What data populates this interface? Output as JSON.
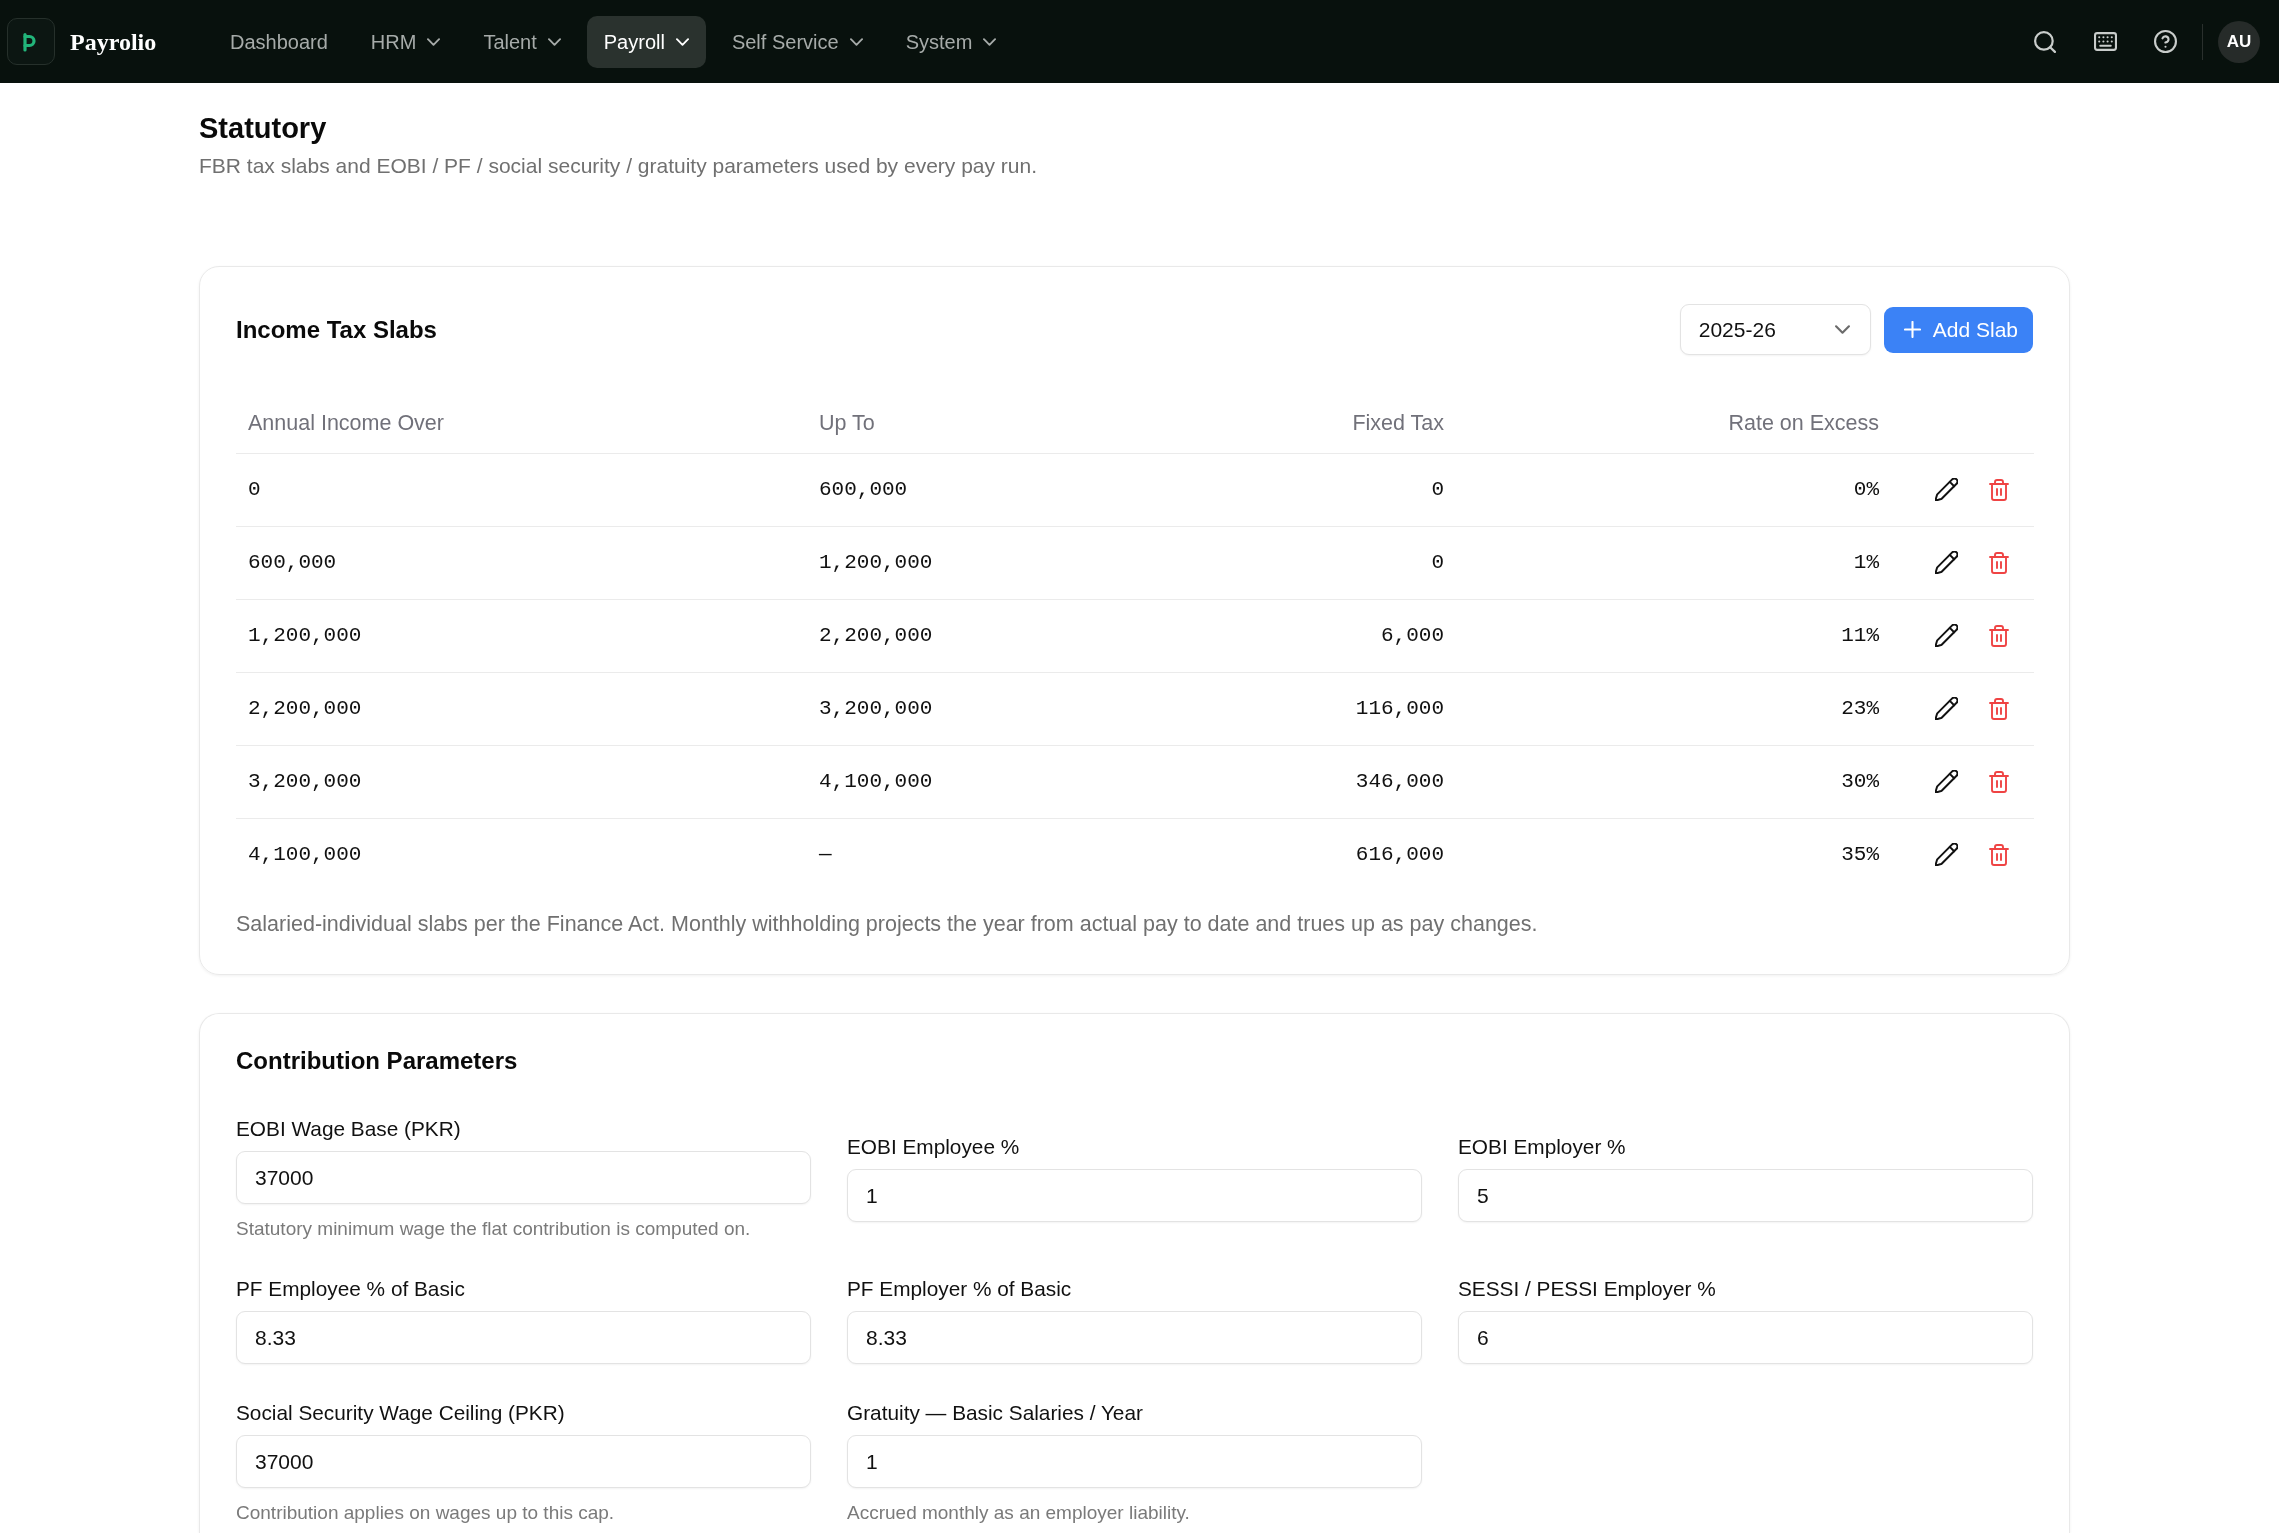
{
  "navbar": {
    "brand": "Payrolio",
    "items": [
      {
        "label": "Dashboard",
        "has_menu": false,
        "selected": false
      },
      {
        "label": "HRM",
        "has_menu": true,
        "selected": false
      },
      {
        "label": "Talent",
        "has_menu": true,
        "selected": false
      },
      {
        "label": "Payroll",
        "has_menu": true,
        "selected": true
      },
      {
        "label": "Self Service",
        "has_menu": true,
        "selected": false
      },
      {
        "label": "System",
        "has_menu": true,
        "selected": false
      }
    ],
    "avatar": "AU"
  },
  "page": {
    "title": "Statutory",
    "subtitle": "FBR tax slabs and EOBI / PF / social security / gratuity parameters used by every pay run."
  },
  "tax_slabs": {
    "title": "Income Tax Slabs",
    "year_select": {
      "value": "2025-26"
    },
    "add_button": {
      "label": "Add Slab"
    },
    "table": {
      "columns": [
        "Annual Income Over",
        "Up To",
        "Fixed Tax",
        "Rate on Excess"
      ],
      "rows": [
        [
          "0",
          "600,000",
          "0",
          "0%"
        ],
        [
          "600,000",
          "1,200,000",
          "0",
          "1%"
        ],
        [
          "1,200,000",
          "2,200,000",
          "6,000",
          "11%"
        ],
        [
          "2,200,000",
          "3,200,000",
          "116,000",
          "23%"
        ],
        [
          "3,200,000",
          "4,100,000",
          "346,000",
          "30%"
        ],
        [
          "4,100,000",
          "—",
          "616,000",
          "35%"
        ]
      ]
    },
    "note": "Salaried-individual slabs per the Finance Act. Monthly withholding projects the year from actual pay to date and trues up as pay changes."
  },
  "contribution_parameters": {
    "title": "Contribution Parameters",
    "fields": [
      {
        "label": "EOBI Wage Base (PKR)",
        "value": "37000",
        "help": "Statutory minimum wage the flat contribution is computed on."
      },
      {
        "label": "EOBI Employee %",
        "value": "1"
      },
      {
        "label": "EOBI Employer %",
        "value": "5"
      },
      {
        "label": "PF Employee % of Basic",
        "value": "8.33"
      },
      {
        "label": "PF Employer % of Basic",
        "value": "8.33"
      },
      {
        "label": "SESSI / PESSI Employer %",
        "value": "6"
      },
      {
        "label": "Social Security Wage Ceiling (PKR)",
        "value": "37000",
        "help": "Contribution applies on wages up to this cap."
      },
      {
        "label": "Gratuity — Basic Salaries / Year",
        "value": "1",
        "help": "Accrued monthly as an employer liability."
      }
    ]
  }
}
